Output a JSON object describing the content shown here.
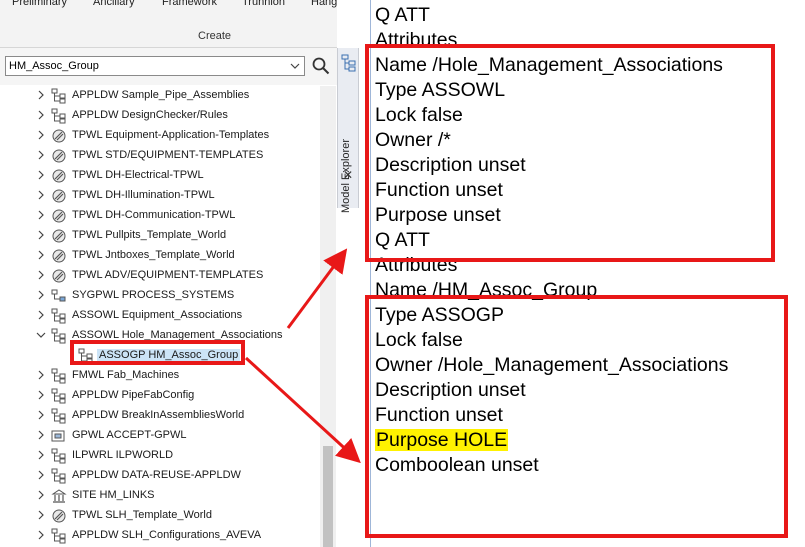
{
  "ribbon": {
    "tabs": [
      "Preliminary",
      "Ancillary",
      "Framework",
      "Trunnion",
      "Hanger"
    ],
    "group_label": "Create"
  },
  "search": {
    "value": "HM_Assoc_Group"
  },
  "side_tab": {
    "label": "Model Explorer",
    "close_glyph": "✕"
  },
  "tree": {
    "items": [
      {
        "label": "APPLDW Sample_Pipe_Assemblies",
        "icon": "structure-icon",
        "selected": false
      },
      {
        "label": "APPLDW DesignChecker/Rules",
        "icon": "structure-icon",
        "selected": false
      },
      {
        "label": "TPWL Equipment-Application-Templates",
        "icon": "template-world-icon",
        "selected": false
      },
      {
        "label": "TPWL STD/EQUIPMENT-TEMPLATES",
        "icon": "template-world-icon",
        "selected": false
      },
      {
        "label": "TPWL DH-Electrical-TPWL",
        "icon": "template-world-icon",
        "selected": false
      },
      {
        "label": "TPWL DH-Illumination-TPWL",
        "icon": "template-world-icon",
        "selected": false
      },
      {
        "label": "TPWL DH-Communication-TPWL",
        "icon": "template-world-icon",
        "selected": false
      },
      {
        "label": "TPWL Pullpits_Template_World",
        "icon": "template-world-icon",
        "selected": false
      },
      {
        "label": "TPWL Jntboxes_Template_World",
        "icon": "template-world-icon",
        "selected": false
      },
      {
        "label": "TPWL ADV/EQUIPMENT-TEMPLATES",
        "icon": "template-world-icon",
        "selected": false
      },
      {
        "label": "SYGPWL PROCESS_SYSTEMS",
        "icon": "system-icon",
        "selected": false
      },
      {
        "label": "ASSOWL Equipment_Associations",
        "icon": "structure-icon",
        "selected": false
      },
      {
        "label": "ASSOWL Hole_Management_Associations",
        "icon": "structure-icon",
        "selected": false
      },
      {
        "label": "ASSOGP HM_Assoc_Group",
        "icon": "structure-icon",
        "selected": true
      },
      {
        "label": "FMWL Fab_Machines",
        "icon": "structure-icon",
        "selected": false
      },
      {
        "label": "APPLDW PipeFabConfig",
        "icon": "structure-icon",
        "selected": false
      },
      {
        "label": "APPLDW BreakInAssembliesWorld",
        "icon": "structure-icon",
        "selected": false
      },
      {
        "label": "GPWL ACCEPT-GPWL",
        "icon": "group-world-icon",
        "selected": false
      },
      {
        "label": "ILPWRL ILPWORLD",
        "icon": "structure-icon",
        "selected": false
      },
      {
        "label": "APPLDW DATA-REUSE-APPLDW",
        "icon": "structure-icon",
        "selected": false
      },
      {
        "label": "SITE HM_LINKS",
        "icon": "site-icon",
        "selected": false
      },
      {
        "label": "TPWL SLH_Template_World",
        "icon": "template-world-icon",
        "selected": false
      },
      {
        "label": "APPLDW SLH_Configurations_AVEVA",
        "icon": "structure-icon",
        "selected": false
      }
    ]
  },
  "output": {
    "lines": [
      "Q ATT",
      "Attributes",
      "Name /Hole_Management_Associations",
      "Type ASSOWL",
      "Lock false",
      "Owner /*",
      "Description unset",
      "Function unset",
      "Purpose unset",
      "Q ATT",
      "Attributes",
      "Name /HM_Assoc_Group",
      "Type ASSOGP",
      "Lock false",
      "Owner /Hole_Management_Associations",
      "Description unset",
      "Function unset",
      "Purpose HOLE",
      "Comboolean unset"
    ]
  },
  "colors": {
    "annotation_red": "#e81818",
    "highlight_yellow": "#fff200",
    "selection_blue": "#cce4f7"
  }
}
